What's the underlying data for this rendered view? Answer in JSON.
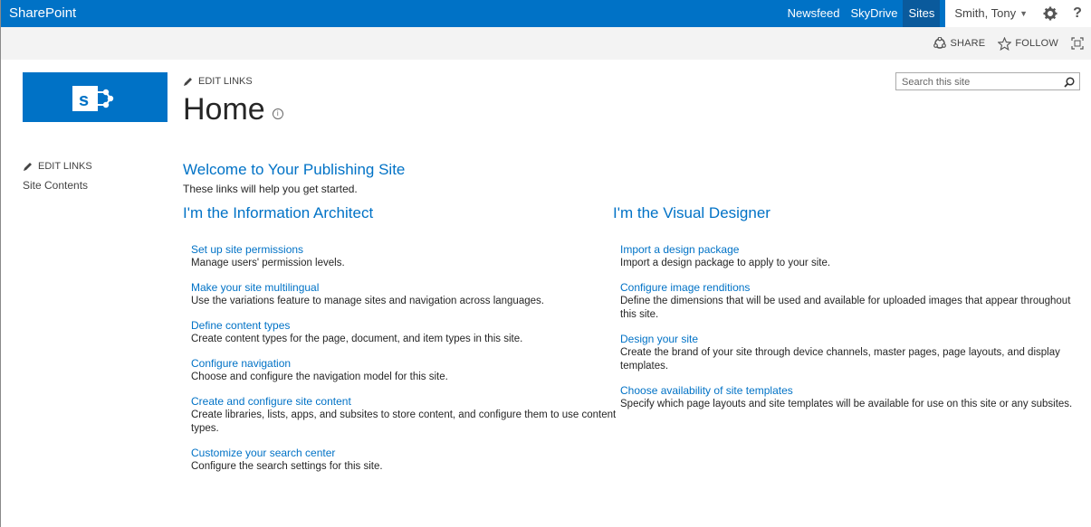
{
  "suite_bar": {
    "brand": "SharePoint",
    "links": [
      "Newsfeed",
      "SkyDrive",
      "Sites"
    ],
    "user": "Smith, Tony",
    "settings_icon": "gear-icon",
    "help_label": "?"
  },
  "ribbon": {
    "share_label": "SHARE",
    "follow_label": "FOLLOW"
  },
  "header": {
    "edit_links_label": "EDIT LINKS",
    "title": "Home"
  },
  "search": {
    "placeholder": "Search this site"
  },
  "left_nav": {
    "edit_links_label": "EDIT LINKS",
    "items": [
      "Site Contents"
    ]
  },
  "main": {
    "welcome": "Welcome to Your Publishing Site",
    "intro": "These links will help you get started.",
    "architect": {
      "heading": "I'm the Information Architect",
      "links": [
        {
          "title": "Set up site permissions",
          "desc": "Manage users' permission levels."
        },
        {
          "title": "Make your site multilingual",
          "desc": "Use the variations feature to manage sites and navigation across languages."
        },
        {
          "title": "Define content types",
          "desc": "Create content types for the page, document, and item types in this site."
        },
        {
          "title": "Configure navigation",
          "desc": "Choose and configure the navigation model for this site."
        },
        {
          "title": "Create and configure site content",
          "desc": "Create libraries, lists, apps, and subsites to store content, and configure them to use content types."
        },
        {
          "title": "Customize your search center",
          "desc": "Configure the search settings for this site."
        }
      ]
    },
    "designer": {
      "heading": "I'm the Visual Designer",
      "links": [
        {
          "title": "Import a design package",
          "desc": "Import a design package to apply to your site."
        },
        {
          "title": "Configure image renditions",
          "desc": "Define the dimensions that will be used and available for uploaded images that appear throughout this site."
        },
        {
          "title": "Design your site",
          "desc": "Create the brand of your site through device channels, master pages, page layouts, and display templates."
        },
        {
          "title": "Choose availability of site templates",
          "desc": "Specify which page layouts and site templates will be available for use on this site or any subsites."
        }
      ]
    }
  },
  "colors": {
    "accent": "#0072c6",
    "ribbon_bg": "#f3f3f3"
  }
}
